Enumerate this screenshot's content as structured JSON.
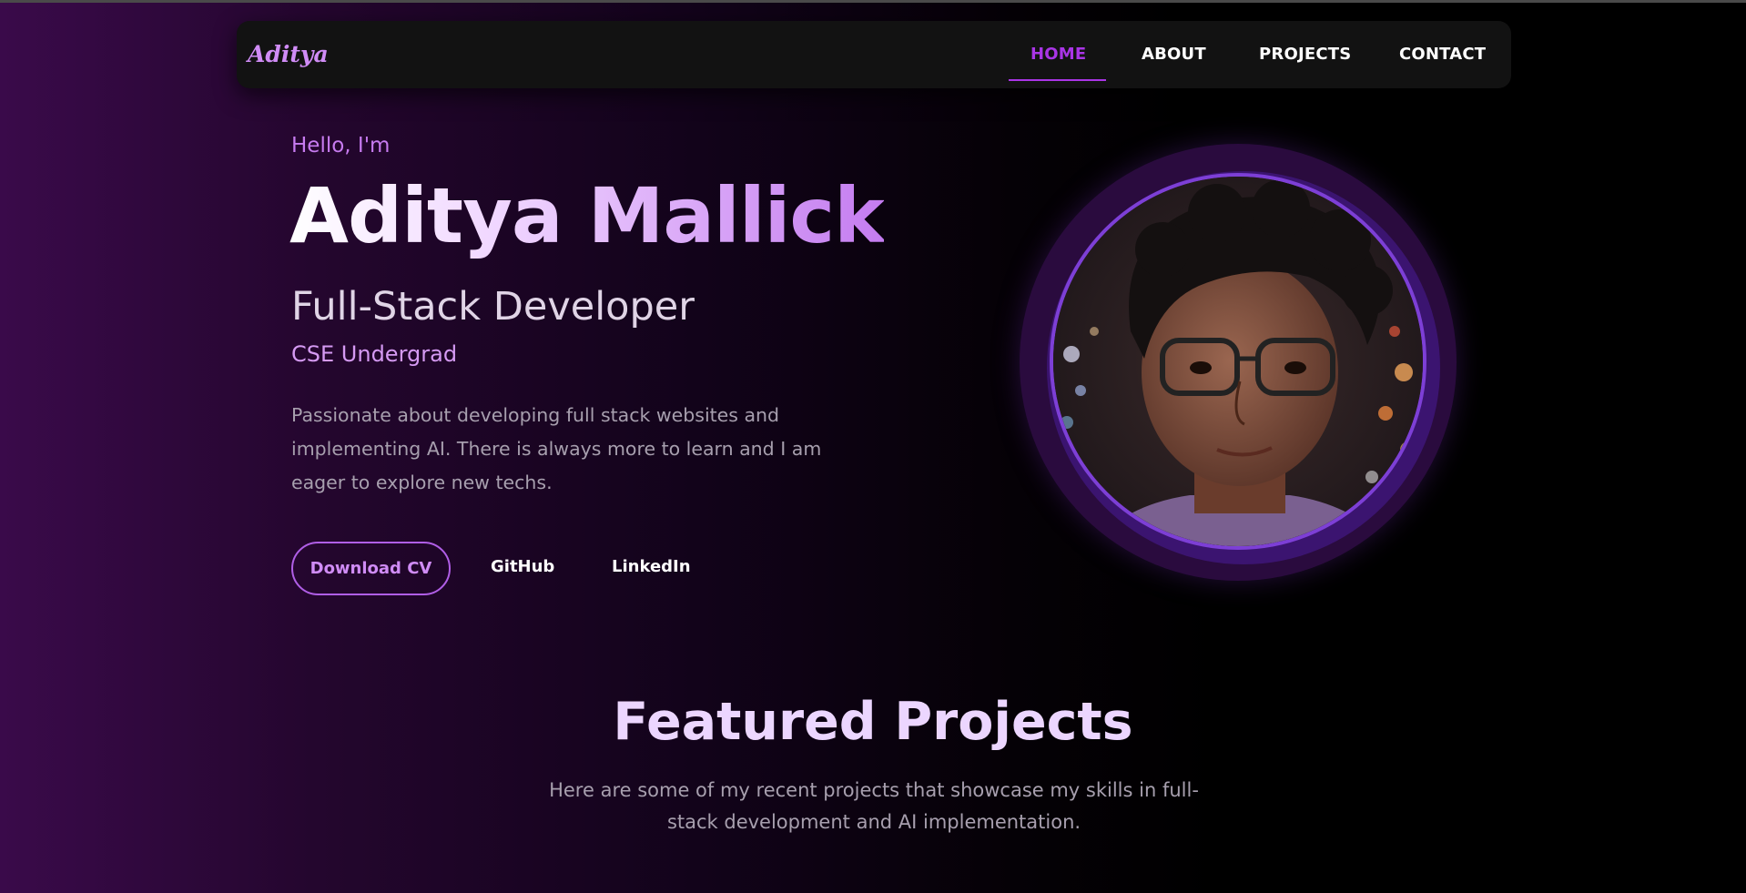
{
  "navbar": {
    "logo": "Aditya",
    "links": [
      "HOME",
      "ABOUT",
      "PROJECTS",
      "CONTACT"
    ],
    "active_link": "HOME",
    "accent_color": "#a935e6"
  },
  "hero": {
    "greeting": "Hello, I'm",
    "name": "Aditya Mallick",
    "role": "Full-Stack Developer",
    "subtitle": "CSE Undergrad",
    "description": "Passionate about developing full stack websites and implementing AI. There is always more to learn and I am eager to explore new techs.",
    "buttons": {
      "cv": "Download CV",
      "github": "GitHub",
      "linkedin": "LinkedIn"
    }
  },
  "featured": {
    "title": "Featured Projects",
    "description": "Here are some of my recent projects that showcase my skills in full-stack development and AI implementation."
  },
  "colors": {
    "background_left": "#3a0a4a",
    "background_right": "#000000",
    "accent": "#c77bf0"
  }
}
